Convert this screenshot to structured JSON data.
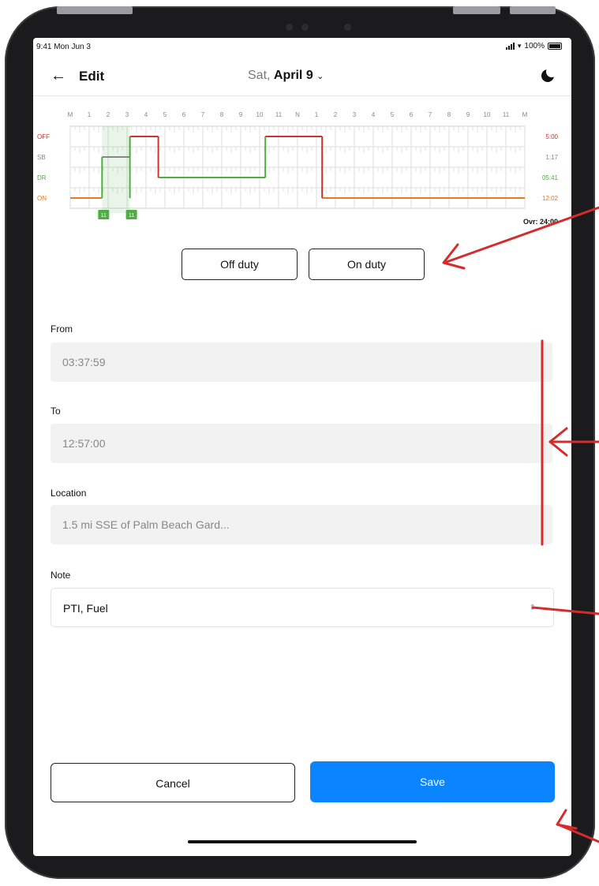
{
  "status_bar": {
    "time": "9:41 Mon Jun 3",
    "battery": "100%"
  },
  "nav": {
    "title": "Edit",
    "date_weekday": "Sat,",
    "date_main": "April 9"
  },
  "graph": {
    "hour_labels": [
      "M",
      "1",
      "2",
      "3",
      "4",
      "5",
      "6",
      "7",
      "8",
      "9",
      "10",
      "11",
      "N",
      "1",
      "2",
      "3",
      "4",
      "5",
      "6",
      "7",
      "8",
      "9",
      "10",
      "11",
      "M"
    ],
    "rows": [
      {
        "label": "OFF",
        "total": "5:00",
        "color": "#d0312d"
      },
      {
        "label": "SB",
        "total": "1:17",
        "color": "#888888"
      },
      {
        "label": "DR",
        "total": "05:41",
        "color": "#4caf3f"
      },
      {
        "label": "ON",
        "total": "12:02",
        "color": "#e8791f"
      }
    ],
    "marker_labels": [
      "11",
      "11"
    ],
    "total_label": "Ovr: 24:00"
  },
  "buttons": {
    "off_duty": "Off duty",
    "on_duty": "On duty",
    "cancel": "Cancel",
    "save": "Save"
  },
  "form": {
    "from": {
      "label": "From",
      "value": "03:37:59"
    },
    "to": {
      "label": "To",
      "value": "12:57:00"
    },
    "location": {
      "label": "Location",
      "value": "1.5 mi SSE of Palm Beach Gard..."
    },
    "note": {
      "label": "Note",
      "value": "PTI, Fuel"
    }
  }
}
